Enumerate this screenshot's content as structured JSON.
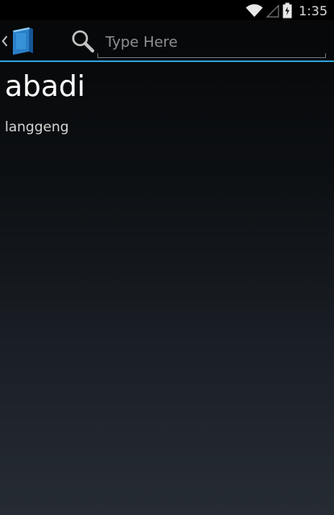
{
  "status_bar": {
    "time": "1:35",
    "icons": [
      "wifi-icon",
      "signal-icon",
      "battery-icon"
    ]
  },
  "action_bar": {
    "up_icon": "chevron-left-icon",
    "app_icon": "book-icon",
    "search_icon": "search-icon",
    "search_placeholder": "Type Here",
    "search_value": "",
    "accent_color": "#2f9ed4"
  },
  "content": {
    "word": "abadi",
    "definition": "langgeng"
  }
}
